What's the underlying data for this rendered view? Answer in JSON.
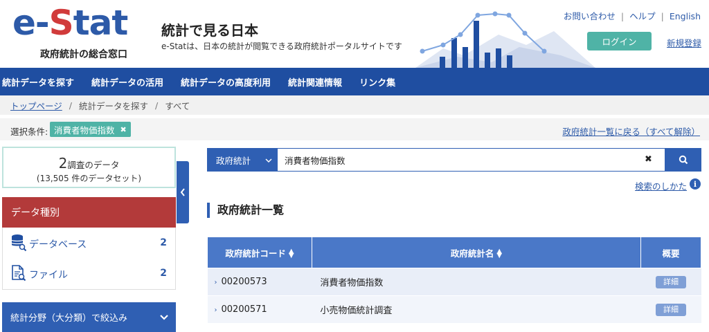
{
  "header": {
    "logo_e": "e-",
    "logo_s": "S",
    "logo_tat": "tat",
    "logo_sub": "政府統計の総合窓口",
    "title": "統計で見る日本",
    "description": "e-Statは、日本の統計が閲覧できる政府統計ポータルサイトです",
    "links": [
      "お問い合わせ",
      "ヘルプ",
      "English"
    ],
    "link_separator": "|",
    "login": "ログイン",
    "register": "新規登録"
  },
  "nav": {
    "items": [
      "統計データを探す",
      "統計データの活用",
      "統計データの高度利用",
      "統計関連情報",
      "リンク集"
    ]
  },
  "breadcrumb": {
    "items": [
      "トップページ",
      "統計データを探す",
      "すべて"
    ],
    "separator": "/"
  },
  "filter": {
    "label": "選択条件:",
    "tag": "消費者物価指数",
    "tag_remove": "✖",
    "back_link": "政府統計一覧に戻る（すべて解除）"
  },
  "summary": {
    "count": "2",
    "count_suffix": "調査のデータ",
    "datasets": "(13,505 件のデータセット)"
  },
  "data_type": {
    "heading": "データ種別",
    "items": [
      {
        "label": "データベース",
        "count": "2",
        "icon": "database-icon"
      },
      {
        "label": "ファイル",
        "count": "2",
        "icon": "file-icon"
      }
    ]
  },
  "field_filter": {
    "heading": "統計分野（大分類）で絞込み"
  },
  "search": {
    "category": "政府統計",
    "query": "消費者物価指数",
    "clear": "✖",
    "howto": "検索のしかた",
    "info": "i"
  },
  "list": {
    "title": "政府統計一覧",
    "columns": [
      "政府統計コード",
      "政府統計名",
      "概要"
    ],
    "rows": [
      {
        "code": "00200573",
        "name": "消費者物価指数",
        "detail": "詳細"
      },
      {
        "code": "00200571",
        "name": "小売物価統計調査",
        "detail": "詳細"
      }
    ]
  },
  "colors": {
    "brand_blue": "#1f4ea1",
    "accent_teal": "#4fb3a6",
    "section_red": "#b33a3a",
    "logo_red": "#d13b3b"
  }
}
